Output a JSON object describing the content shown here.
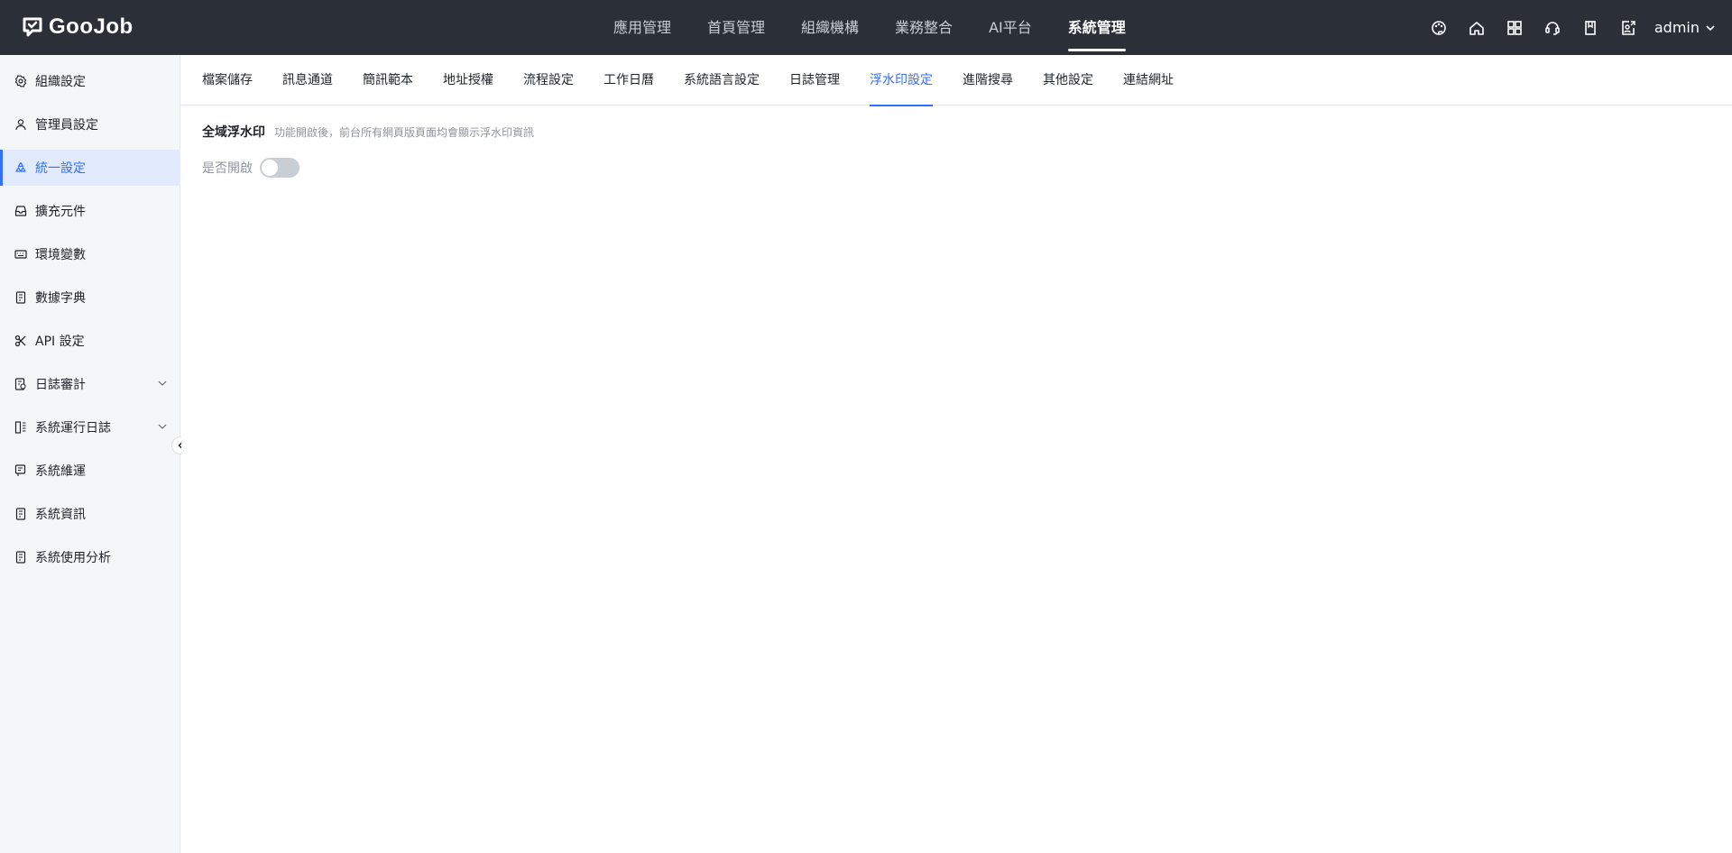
{
  "header": {
    "logo_text": "GooJob",
    "nav": [
      {
        "label": "應用管理",
        "active": false
      },
      {
        "label": "首頁管理",
        "active": false
      },
      {
        "label": "組織機構",
        "active": false
      },
      {
        "label": "業務整合",
        "active": false
      },
      {
        "label": "AI平台",
        "active": false
      },
      {
        "label": "系統管理",
        "active": true
      }
    ],
    "tools": [
      "palette-icon",
      "home-icon",
      "grid-apps-icon",
      "support-headset-icon",
      "book-icon",
      "user-external-icon"
    ],
    "username": "admin"
  },
  "sidebar": {
    "items": [
      {
        "label": "組織設定",
        "icon": "gear-icon"
      },
      {
        "label": "管理員設定",
        "icon": "user-icon"
      },
      {
        "label": "統一設定",
        "icon": "recycle-icon",
        "active": true
      },
      {
        "label": "擴充元件",
        "icon": "inbox-icon"
      },
      {
        "label": "環境變數",
        "icon": "keyboard-icon"
      },
      {
        "label": "數據字典",
        "icon": "book-icon"
      },
      {
        "label": "API 設定",
        "icon": "scissors-icon"
      },
      {
        "label": "日誌審計",
        "icon": "audit-log-icon",
        "expandable": true
      },
      {
        "label": "系統運行日誌",
        "icon": "log-list-icon",
        "expandable": true
      },
      {
        "label": "系統維運",
        "icon": "maintenance-icon"
      },
      {
        "label": "系統資訊",
        "icon": "info-doc-icon"
      },
      {
        "label": "系統使用分析",
        "icon": "analytics-doc-icon"
      }
    ]
  },
  "tabs": [
    {
      "label": "檔案儲存"
    },
    {
      "label": "訊息通道"
    },
    {
      "label": "簡訊範本"
    },
    {
      "label": "地址授權"
    },
    {
      "label": "流程設定"
    },
    {
      "label": "工作日曆"
    },
    {
      "label": "系統語言設定"
    },
    {
      "label": "日誌管理"
    },
    {
      "label": "浮水印設定",
      "active": true
    },
    {
      "label": "進階搜尋"
    },
    {
      "label": "其他設定"
    },
    {
      "label": "連結網址"
    }
  ],
  "watermark": {
    "title": "全域浮水印",
    "description": "功能開啟後，前台所有網頁版頁面均會顯示浮水印資訊",
    "toggle_label": "是否開啟",
    "enabled": false
  },
  "colors": {
    "header_bg": "#2b2f38",
    "accent": "#3370ff",
    "sidebar_bg": "#f5f6f8"
  }
}
